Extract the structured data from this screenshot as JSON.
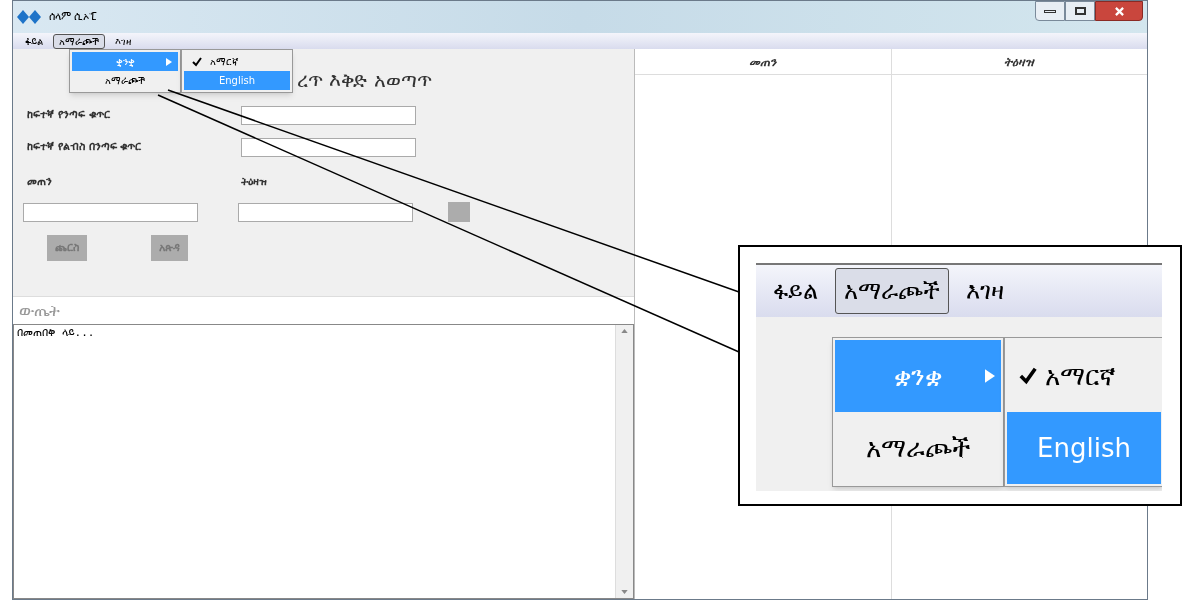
{
  "window": {
    "title": "ሰላም ሲኦፒ"
  },
  "menu_bar": [
    {
      "label": "ፋይል",
      "selected": false
    },
    {
      "label": "አማራጮች",
      "selected": true
    },
    {
      "label": "እገዛ",
      "selected": false
    }
  ],
  "dropdown": [
    {
      "label": "ቋንቋ",
      "selected": true,
      "submenu": true
    },
    {
      "label": "አማራጮች",
      "selected": false,
      "submenu": false
    }
  ],
  "submenu": [
    {
      "label": "አማርኛ",
      "checked": true,
      "selected": false
    },
    {
      "label": "English",
      "checked": false,
      "selected": true
    }
  ],
  "form": {
    "heading": "ረጥ እቅድ አወጣጥ",
    "fields": [
      {
        "label": "ከፍተኛ የንጣፍ ቁጥር"
      },
      {
        "label": "ከፍተኛ የልብስ በንጣፍ ቁጥር"
      }
    ],
    "size_label": "መጠን",
    "order_label": "ትዕዛዝ",
    "buttons": [
      "ጨርስ",
      "አጽዳ"
    ]
  },
  "output": {
    "title": "ውጤት",
    "text": "በመጠበቅ ላይ..."
  },
  "table": {
    "columns": [
      "መጠን",
      "ትዕዛዝ"
    ]
  },
  "zoom_callout": {
    "menu_bar": [
      {
        "label": "ፋይል",
        "selected": false
      },
      {
        "label": "አማራጮች",
        "selected": true
      },
      {
        "label": "እገዛ",
        "selected": false
      }
    ],
    "dropdown": [
      {
        "label": "ቋንቋ",
        "selected": true,
        "submenu": true
      },
      {
        "label": "አማራጮች",
        "selected": false,
        "submenu": false
      }
    ],
    "submenu": [
      {
        "label": "አማርኛ",
        "checked": true,
        "selected": false
      },
      {
        "label": "English",
        "checked": false,
        "selected": true
      }
    ]
  }
}
